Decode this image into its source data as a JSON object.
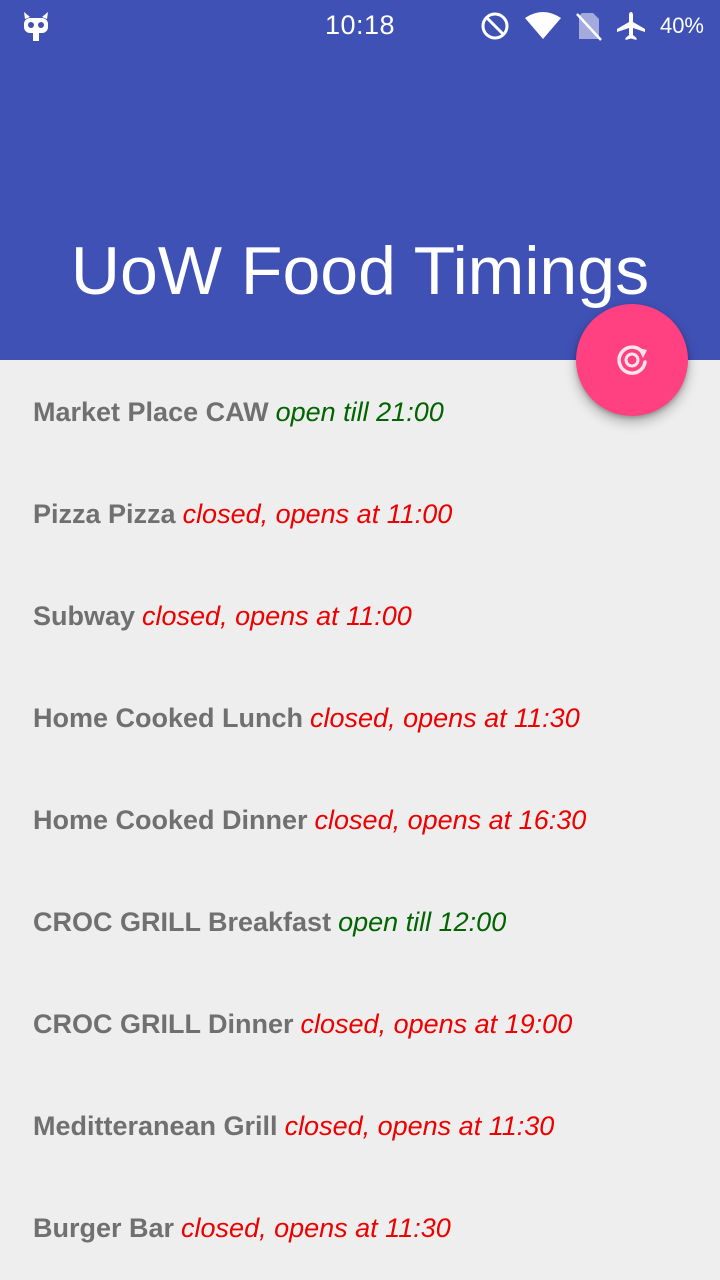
{
  "status_bar": {
    "time": "10:18",
    "battery": "40%",
    "icons": [
      "cyanogenmod-bot-icon",
      "do-not-disturb-icon",
      "wifi-icon",
      "no-sim-icon",
      "airplane-mode-icon"
    ]
  },
  "app": {
    "title": "UoW Food Timings",
    "fab_icon": "refresh-icon",
    "colors": {
      "app_bar": "#3f51b5",
      "fab": "#ff4081",
      "open": "#006400",
      "closed": "#ee0000",
      "venue_text": "#707070",
      "background": "#eeeeee"
    }
  },
  "venues": [
    {
      "name": "Market Place CAW",
      "status": "open till 21:00",
      "state": "open"
    },
    {
      "name": "Pizza Pizza",
      "status": "closed, opens at 11:00",
      "state": "closed"
    },
    {
      "name": "Subway",
      "status": "closed, opens at 11:00",
      "state": "closed"
    },
    {
      "name": "Home Cooked Lunch",
      "status": "closed, opens at 11:30",
      "state": "closed"
    },
    {
      "name": "Home Cooked Dinner",
      "status": "closed, opens at 16:30",
      "state": "closed"
    },
    {
      "name": "CROC GRILL Breakfast",
      "status": "open till 12:00",
      "state": "open"
    },
    {
      "name": "CROC GRILL Dinner",
      "status": "closed, opens at 19:00",
      "state": "closed"
    },
    {
      "name": "Meditteranean Grill",
      "status": "closed, opens at 11:30",
      "state": "closed"
    },
    {
      "name": "Burger Bar",
      "status": "closed, opens at 11:30",
      "state": "closed"
    }
  ]
}
